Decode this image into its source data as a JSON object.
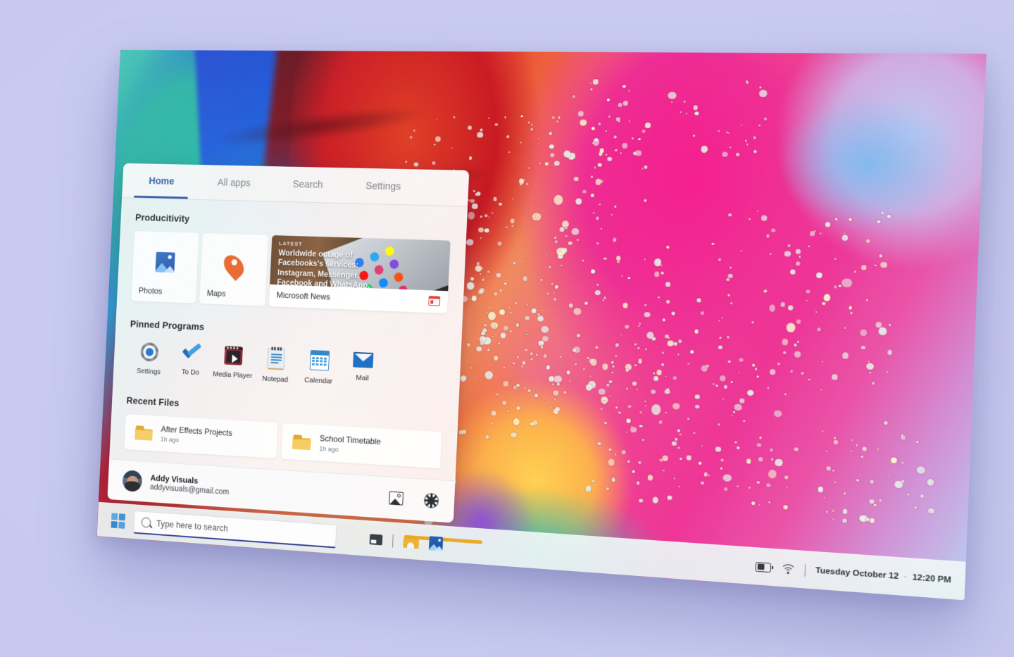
{
  "desktop": {
    "wallpaper_name": "abstract-watercolor-ink-wallpaper",
    "background_color": "#c9cbf0",
    "accent_color": "#2a4fa8"
  },
  "start_menu": {
    "tabs": [
      {
        "label": "Home",
        "active": true
      },
      {
        "label": "All apps",
        "active": false
      },
      {
        "label": "Search",
        "active": false
      },
      {
        "label": "Settings",
        "active": false
      }
    ],
    "sections": {
      "productivity": {
        "title": "Producitivity",
        "tiles": [
          {
            "label": "Photos",
            "icon": "photos-icon"
          },
          {
            "label": "Maps",
            "icon": "map-pin-icon"
          }
        ],
        "news": {
          "badge": "LATEST",
          "headline": "Worldwide outage of Facebooks's services: Instagram, Messenger, Facebook and WhatsApp.",
          "source": "Microsoft News",
          "source_icon": "msn-news-icon"
        }
      },
      "pinned": {
        "title": "Pinned Programs",
        "items": [
          {
            "label": "Settings",
            "icon": "gear-icon"
          },
          {
            "label": "To Do",
            "icon": "check-icon"
          },
          {
            "label": "Media Player",
            "icon": "media-player-icon"
          },
          {
            "label": "Notepad",
            "icon": "notepad-icon"
          },
          {
            "label": "Calendar",
            "icon": "calendar-icon"
          },
          {
            "label": "Mail",
            "icon": "mail-icon"
          }
        ]
      },
      "recent": {
        "title": "Recent Files",
        "items": [
          {
            "name": "After Effects Projects",
            "time": "1h ago",
            "icon": "folder-icon"
          },
          {
            "name": "School Timetable",
            "time": "1h ago",
            "icon": "folder-icon"
          }
        ]
      }
    },
    "account": {
      "name": "Addy Visuals",
      "email": "addyvisuals@gmail.com",
      "avatar_icon": "user-avatar",
      "actions": [
        {
          "icon": "picture-icon",
          "name": "pictures"
        },
        {
          "icon": "gear-icon",
          "name": "settings"
        }
      ]
    }
  },
  "taskbar": {
    "start_button": "start-button",
    "search": {
      "placeholder": "Type here to search",
      "value": "",
      "icon": "search-icon"
    },
    "icons": [
      {
        "name": "task-view-icon"
      },
      {
        "name": "file-explorer-icon"
      },
      {
        "name": "photos-icon"
      }
    ],
    "tray": {
      "battery_icon": "battery-icon",
      "wifi_icon": "wifi-icon",
      "date": "Tuesday October 12",
      "separator": "·",
      "time": "12:20 PM"
    }
  }
}
